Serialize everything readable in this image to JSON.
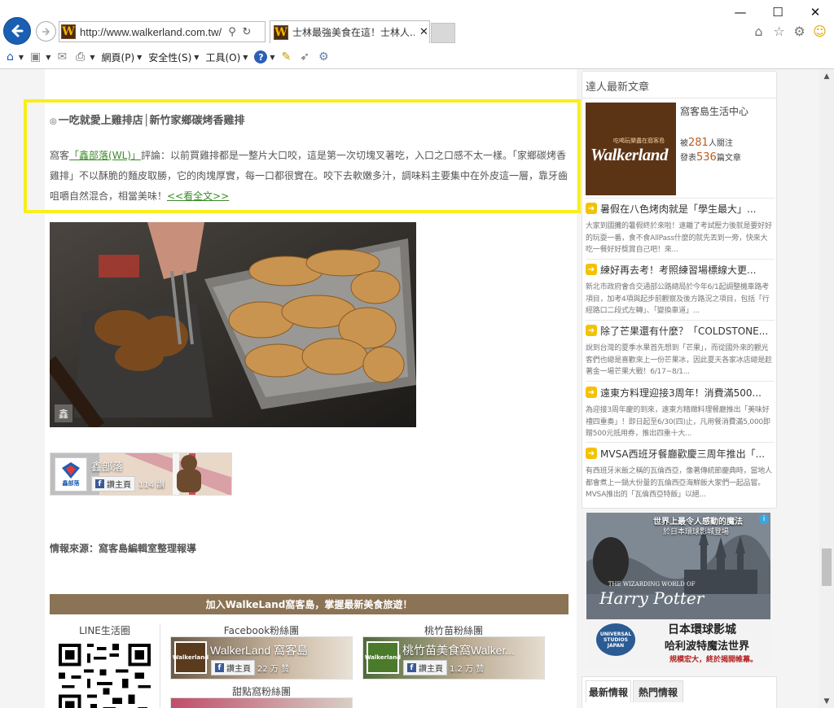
{
  "browser": {
    "url": "http://www.walkerland.com.tw/",
    "tab_title": "士林最強美食在這！士林人...",
    "favicon_letter": "W",
    "tab_close": "✕",
    "controls": {
      "minimize": "—",
      "maximize": "☐",
      "close": "✕"
    },
    "right_icons": [
      "home-icon",
      "star-icon",
      "gear-icon",
      "smiley-icon"
    ],
    "command_bar": {
      "page_label": "網頁(P)",
      "safety_label": "安全性(S)",
      "tools_label": "工具(O)"
    }
  },
  "post": {
    "title_bullet": "◎",
    "title": "一吃就愛上雞排店│新竹家鄉碳烤香雞排",
    "body_prefix": "窩客",
    "body_link": "「鑫部落(WL)」",
    "body_main": "評論：以前買雞排都是一整片大口咬，這是第一次切塊叉著吃，入口之口感不太一樣。「家鄉碳烤香雞排」不以酥脆的麵皮取勝，它的肉塊厚實，每一口都很實在。咬下去軟嫩多汁，調味料主要集中在外皮這一層，靠牙齒咀嚼自然混合，相當美味！",
    "read_more": "<<看全文>>",
    "photo_watermark": "鑫",
    "fb_page": {
      "name": "鑫部落",
      "like_label": "讚主頁",
      "count": "114 讚",
      "logo_text": "鑫部落"
    },
    "source": "情報來源：窩客島編輯室整理報導"
  },
  "footer": {
    "join_bar": "加入WalkeLand窩客島，掌握最新美食旅遊！",
    "line_heading": "LINE生活圈",
    "facebook_heading": "Facebook粉絲團",
    "taoyuan_heading": "桃竹苗粉絲團",
    "dessert_heading": "甜點窩粉絲團",
    "fb_widgets": [
      {
        "name": "WalkerLand 窩客島",
        "like_label": "讚主頁",
        "count": "22 万 赞"
      },
      {
        "name": "桃竹苗美食窩Walker...",
        "like_label": "讚主頁",
        "count": "1.2 万 赞"
      }
    ]
  },
  "sidebar": {
    "heading": "達人最新文章",
    "profile": {
      "name": "窩客島生活中心",
      "follow_prefix": "被",
      "follow_count": "281",
      "follow_suffix": "人關注",
      "posts_prefix": "發表",
      "posts_count": "536",
      "posts_suffix": "篇文章",
      "logo_tagline": "吃喝玩樂盡在窩客島",
      "logo_word": "Walkerland"
    },
    "articles": [
      {
        "title": "暑假在八色烤肉就是「學生最大」...",
        "desc": "大家到國攤的暑假終於來啦！遠離了考試壓力後就是要好好的玩耍一番，食不食AllPass什麼的就先丟到一旁，快來大吃一餐好好獎賞自己吧！來..."
      },
      {
        "title": "練好再去考！考照練習場標線大更...",
        "desc": "新北市政府會合交通部公路總局於今年6/1起調整機車路考項目，加考4項與起步前觀察及後方路況之項目，包括「行經路口二段式左轉」、「變換車道」..."
      },
      {
        "title": "除了芒果還有什麼？「COLDSTONE...",
        "desc": "說到台灣的夏季水果首先想到「芒果」，而從國外來的觀光客們也總是喜歡來上一份芒果冰，因此夏天各家冰店總是趁著金一場芒果大戰！6/17~8/1..."
      },
      {
        "title": "遠東方料理迎接3周年！消費滿500...",
        "desc": "為迎接3周年慶的到來，遠東方精緻料理餐廳推出「美味好禮四重奏」！即日起至6/30(四)止，凡用餐消費滿5,000即贈500元抵用券，推出四重十大..."
      },
      {
        "title": "MVSA西班牙餐廳歡慶三周年推出「...",
        "desc": "有西班牙米飯之稱的瓦倫西亞，像著傳統節慶典時，當地人都會煮上一鍋大份量的瓦倫西亞海鮮飯大家們一起品嘗。MVSA推出的「瓦倫西亞特飯」以絕..."
      }
    ],
    "ad": {
      "line1": "世界上最令人感動的魔法",
      "line2": "於日本環球影城登場",
      "world_the": "THE WIZARDING WORLD OF",
      "harry": "Harry Potter",
      "b1": "日本環球影城",
      "b2": "哈利波特魔法世界",
      "b3": "規模宏大，終於揭開帷幕。",
      "universal": "UNIVERSAL STUDIOS JAPAN"
    },
    "tabs": [
      "最新情報",
      "熱門情報"
    ]
  },
  "colors": {
    "highlight": "#f7ef1e",
    "link_green": "#3b8c2a",
    "join_bar": "#8b7355",
    "brand_brown": "#5b3416",
    "number_orange": "#b85c1c"
  }
}
